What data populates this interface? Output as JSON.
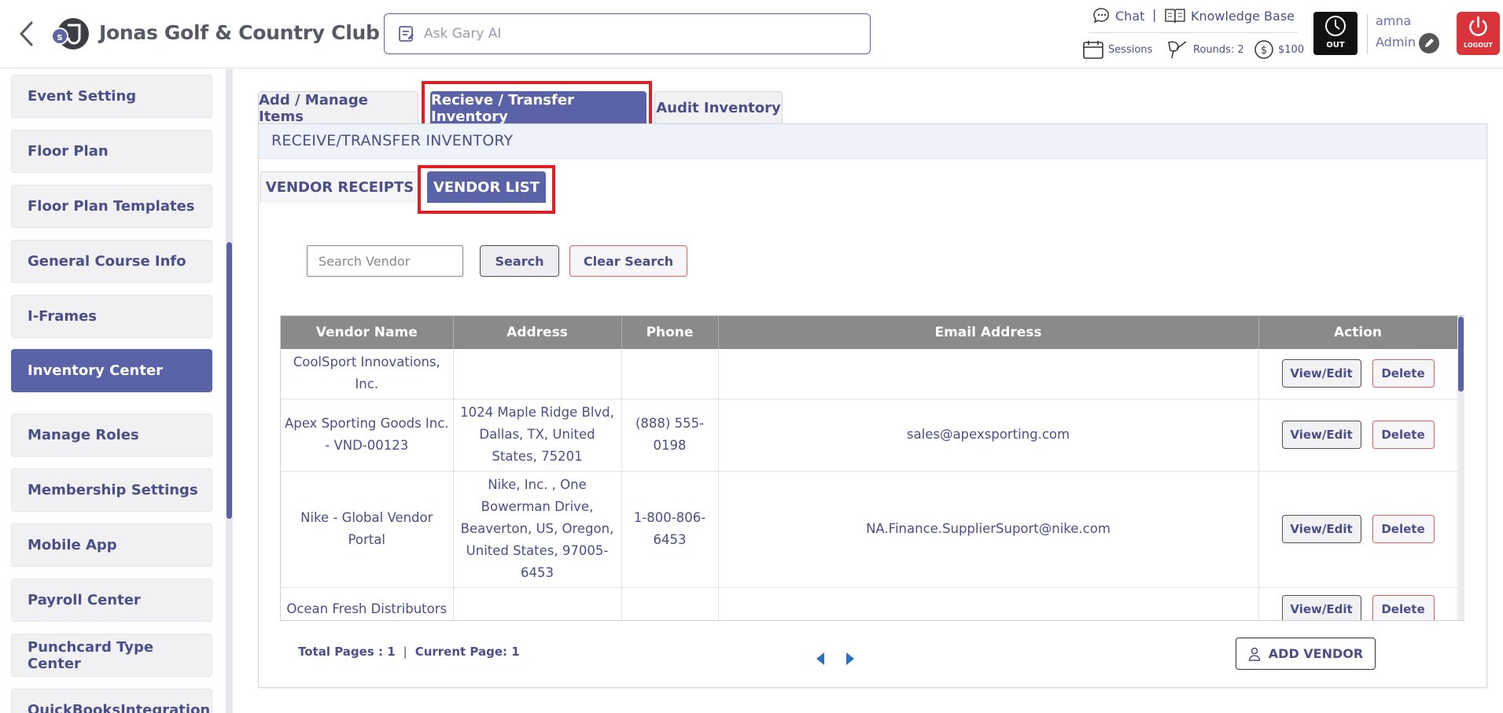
{
  "header": {
    "club_name": "Jonas Golf & Country Club",
    "logo_letter": "s",
    "ask_placeholder": "Ask Gary AI",
    "chat_label": "Chat",
    "separator": "|",
    "knowledge_base_label": "Knowledge Base",
    "sessions_label": "Sessions",
    "rounds_label": "Rounds: 2",
    "balance_label": "$100",
    "clock_out_label": "OUT",
    "user_name": "amna",
    "user_role": "Admin",
    "logout_label": "LOGOUT"
  },
  "sidebar": {
    "items": [
      {
        "label": "Event Setting",
        "active": false
      },
      {
        "label": "Floor Plan",
        "active": false
      },
      {
        "label": "Floor Plan Templates",
        "active": false
      },
      {
        "label": "General Course Info",
        "active": false
      },
      {
        "label": "I-Frames",
        "active": false
      },
      {
        "label": "Inventory Center",
        "active": true
      },
      {
        "label": "Manage Roles",
        "active": false
      },
      {
        "label": "Membership Settings",
        "active": false
      },
      {
        "label": "Mobile App",
        "active": false
      },
      {
        "label": "Payroll Center",
        "active": false
      },
      {
        "label": "Punchcard Type Center",
        "active": false
      },
      {
        "label": "QuickBooksIntegration",
        "active": false
      }
    ]
  },
  "tabs": [
    {
      "label": "Add / Manage Items",
      "active": false
    },
    {
      "label": "Recieve / Transfer Inventory",
      "active": true
    },
    {
      "label": "Audit Inventory",
      "active": false
    }
  ],
  "panel_title": "RECEIVE/TRANSFER INVENTORY",
  "subtabs": [
    {
      "label": "VENDOR RECEIPTS",
      "active": false
    },
    {
      "label": "VENDOR LIST",
      "active": true
    }
  ],
  "search": {
    "placeholder": "Search Vendor",
    "search_label": "Search",
    "clear_label": "Clear Search"
  },
  "table": {
    "columns": [
      "Vendor Name",
      "Address",
      "Phone",
      "Email Address",
      "Action"
    ],
    "rows": [
      {
        "name": "CoolSport Innovations, Inc.",
        "address": "",
        "phone": "",
        "email": ""
      },
      {
        "name": "Apex Sporting Goods Inc. - VND-00123",
        "address": "1024 Maple Ridge Blvd, Dallas, TX, United States, 75201",
        "phone": "(888) 555-0198",
        "email": "sales@apexsporting.com"
      },
      {
        "name": "Nike - Global Vendor Portal",
        "address": "Nike, Inc. , One Bowerman Drive, Beaverton, US, Oregon, United States, 97005-6453",
        "phone": "1-800-806-6453",
        "email": "NA.Finance.SupplierSuport@nike.com"
      },
      {
        "name": "Ocean Fresh Distributors",
        "address": "",
        "phone": "",
        "email": ""
      }
    ],
    "view_label": "View/Edit",
    "delete_label": "Delete"
  },
  "pager": {
    "total_pages": "Total Pages : 1",
    "current_page": "Current Page: 1"
  },
  "add_vendor_label": "ADD VENDOR",
  "colors": {
    "accent": "#5a62a8",
    "text": "#4a4f8a",
    "highlight": "#e01e26",
    "logout": "#d9343a",
    "table_header": "#8a8a8a"
  }
}
